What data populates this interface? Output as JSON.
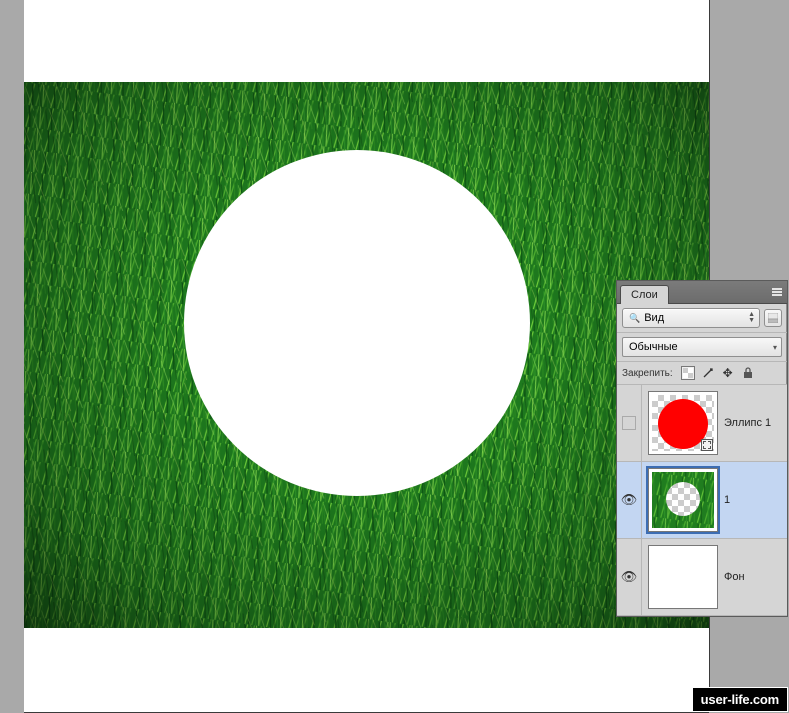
{
  "panel": {
    "tab_label": "Слои",
    "kind_label": "Вид",
    "blend_mode": "Обычные",
    "lock_label": "Закрепить:"
  },
  "layers": [
    {
      "name": "Эллипс 1",
      "visible": false,
      "selected": false,
      "type": "shape-ellipse"
    },
    {
      "name": "1",
      "visible": true,
      "selected": true,
      "type": "grass-hole"
    },
    {
      "name": "Фон",
      "visible": true,
      "selected": false,
      "type": "background"
    }
  ],
  "watermark": "user-life.com"
}
